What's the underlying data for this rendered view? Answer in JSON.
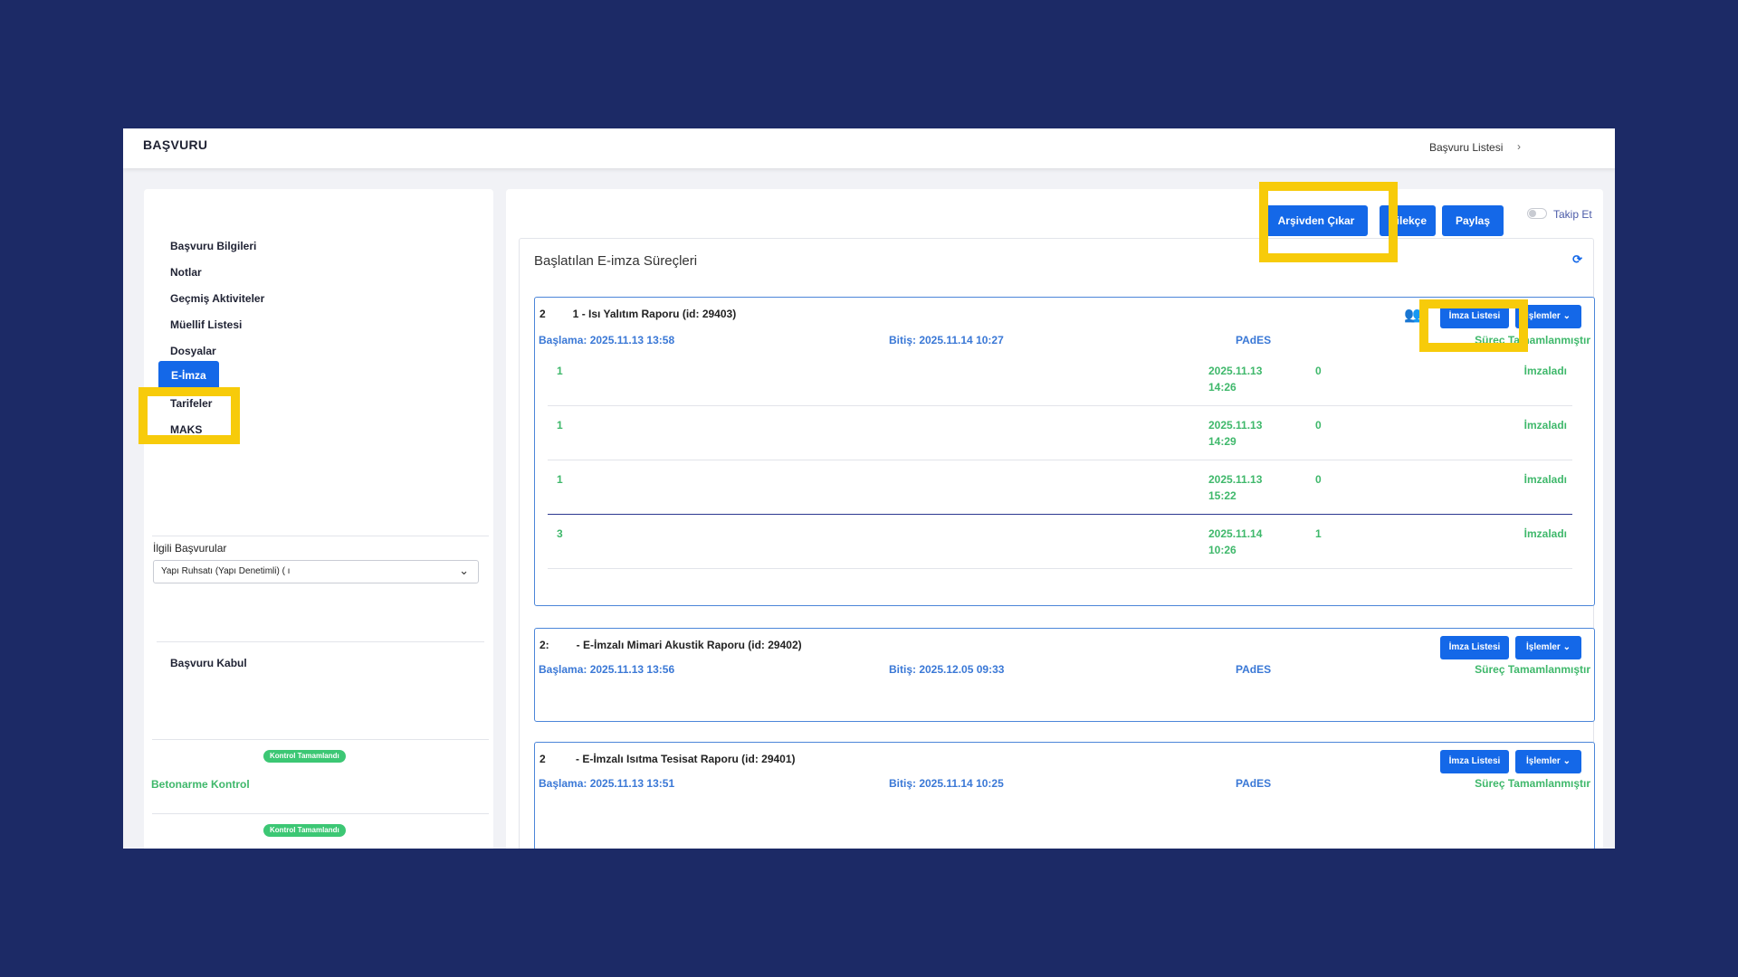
{
  "header": {
    "title": "BAŞVURU",
    "breadcrumb": "Başvuru Listesi",
    "breadcrumb_sep": "›"
  },
  "sidebar": {
    "items": [
      {
        "label": "Başvuru Bilgileri"
      },
      {
        "label": "Notlar"
      },
      {
        "label": "Geçmiş Aktiviteler"
      },
      {
        "label": "Müellif Listesi"
      },
      {
        "label": "Dosyalar"
      },
      {
        "label": "E-İmza"
      },
      {
        "label": "Tarifeler"
      },
      {
        "label": "MAKS"
      }
    ],
    "related_label": "İlgili Başvurular",
    "related_value": "Yapı Ruhsatı (Yapı Denetimli) (          ı",
    "kabul": "Başvuru Kabul",
    "status_pill_1": "Kontrol Tamamlandı",
    "beton": "Betonarme Kontrol",
    "status_pill_2": "Kontrol Tamamlandı"
  },
  "toolbar": {
    "arsiv": "Arşivden Çıkar",
    "dilekce": "Dilekçe",
    "paylas": "Paylaş",
    "takip": "Takip Et"
  },
  "panel": {
    "title": "Başlatılan E-imza Süreçleri",
    "imza_listesi": "İmza Listesi",
    "islemler": "İşlemler",
    "cards": [
      {
        "title": "2         1 - Isı Yalıtım Raporu (id: 29403)",
        "start": "Başlama: 2025.11.13 13:58",
        "end": "Bitiş: 2025.11.14 10:27",
        "type": "PAdES",
        "status": "Süreç Tamamlanmıştır",
        "rows": [
          {
            "order": "1",
            "date": "2025.11.13",
            "time": "14:26",
            "count": "0",
            "state": "İmzaladı"
          },
          {
            "order": "1",
            "date": "2025.11.13",
            "time": "14:29",
            "count": "0",
            "state": "İmzaladı"
          },
          {
            "order": "1",
            "date": "2025.11.13",
            "time": "15:22",
            "count": "0",
            "state": "İmzaladı"
          },
          {
            "order": "3",
            "date": "2025.11.14",
            "time": "10:26",
            "count": "1",
            "state": "İmzaladı"
          }
        ]
      },
      {
        "title": "2:         - E-İmzalı Mimari Akustik Raporu (id: 29402)",
        "start": "Başlama: 2025.11.13 13:56",
        "end": "Bitiş: 2025.12.05 09:33",
        "type": "PAdES",
        "status": "Süreç Tamamlanmıştır"
      },
      {
        "title": "2          - E-İmzalı Isıtma Tesisat Raporu (id: 29401)",
        "start": "Başlama: 2025.11.13 13:51",
        "end": "Bitiş: 2025.11.14 10:25",
        "type": "PAdES",
        "status": "Süreç Tamamlanmıştır"
      }
    ]
  },
  "icons": {
    "refresh": "refresh-icon",
    "users": "users-icon",
    "dropdown": "chevron-down-icon"
  },
  "colors": {
    "background": "#1c2a66",
    "primary": "#1468e8",
    "success": "#3fb86b",
    "highlight": "#f7cb0a"
  }
}
